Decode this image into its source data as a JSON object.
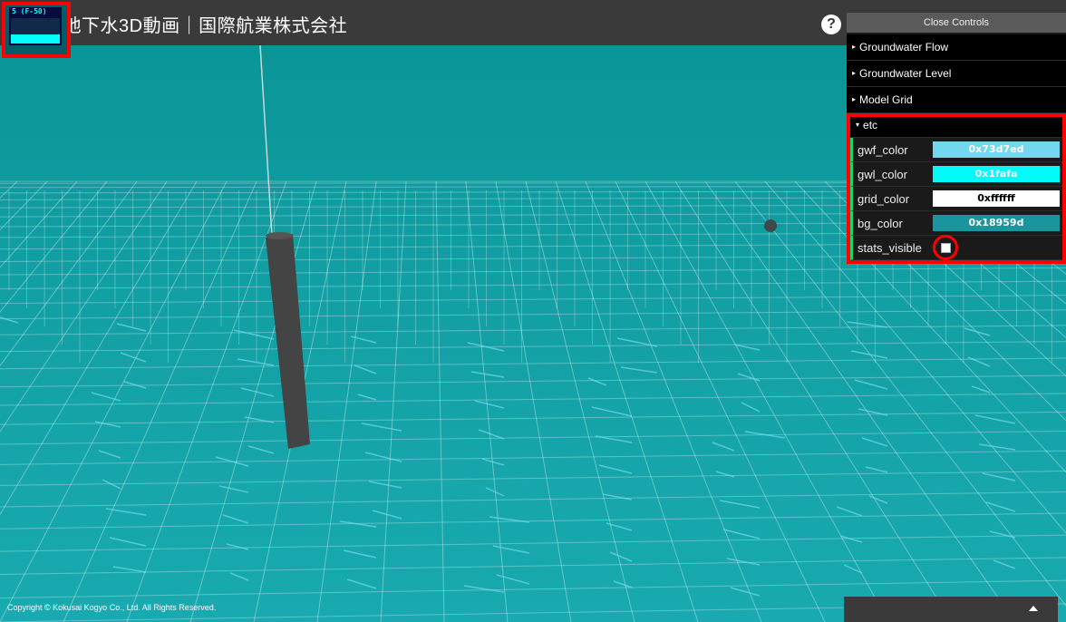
{
  "header": {
    "title": "触れる地下水3D動画｜国際航業株式会社",
    "help_label": "?"
  },
  "stats": {
    "fps_text": "5 (F-50)"
  },
  "controls": {
    "close_label": "Close Controls",
    "folders": [
      {
        "label": "Groundwater Flow"
      },
      {
        "label": "Groundwater Level"
      },
      {
        "label": "Model Grid"
      }
    ],
    "etc": {
      "label": "etc",
      "gwf_color": {
        "label": "gwf_color",
        "value": "0x73d7ed",
        "swatch": "#73d7ed"
      },
      "gwl_color": {
        "label": "gwl_color",
        "value": "0x1fafa",
        "swatch": "#01fafa"
      },
      "grid_color": {
        "label": "grid_color",
        "value": "0xffffff",
        "swatch": "#ffffff"
      },
      "bg_color": {
        "label": "bg_color",
        "value": "0x18959d",
        "swatch": "#18959d"
      },
      "stats_visible": {
        "label": "stats_visible",
        "checked": false
      }
    }
  },
  "footer": {
    "copyright": "Copyright © Kokusai Kogyo Co., Ltd. All Rights Reserved."
  },
  "colors": {
    "header_bg": "#3a3a3a",
    "viewport_bg": "#18959d",
    "grid_line": "#ffffff",
    "flow_line": "#73d7ed",
    "highlight": "#ff0000"
  }
}
